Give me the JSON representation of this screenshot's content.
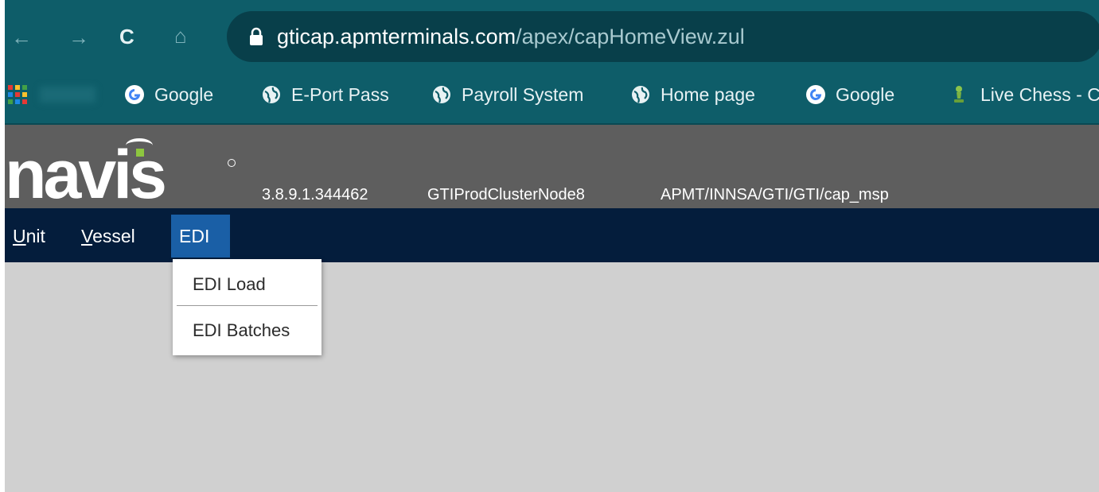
{
  "browser": {
    "url_domain": "gticap.apmterminals.com",
    "url_path": "/apex/capHomeView.zul",
    "back_label": "←",
    "forward_label": "→",
    "reload_label": "C",
    "home_label": "⌂"
  },
  "bookmarks": [
    {
      "label": "Google",
      "icon": "google-icon"
    },
    {
      "label": "E-Port Pass",
      "icon": "globe-icon"
    },
    {
      "label": "Payroll System",
      "icon": "globe-icon"
    },
    {
      "label": "Home page",
      "icon": "globe-icon"
    },
    {
      "label": "Google",
      "icon": "google-icon"
    },
    {
      "label": "Live Chess - C",
      "icon": "chess-pawn-icon"
    }
  ],
  "header": {
    "logo_text": "navis",
    "version": "3.8.9.1.344462",
    "node": "GTIProdClusterNode8",
    "scope": "APMT/INNSA/GTI/GTI/cap_msp"
  },
  "menu": {
    "items": [
      {
        "first": "U",
        "rest": "nit"
      },
      {
        "first": "V",
        "rest": "essel"
      },
      {
        "first": "",
        "rest": "EDI"
      }
    ]
  },
  "dropdown": {
    "items": [
      "EDI Load",
      "EDI Batches"
    ]
  },
  "colors": {
    "browser_chrome": "#0e5d69",
    "header_bg": "#5e5e5e",
    "menubar_bg": "#041d3c",
    "menu_selected": "#1a5fa6",
    "content_bg": "#d0d0d0"
  }
}
